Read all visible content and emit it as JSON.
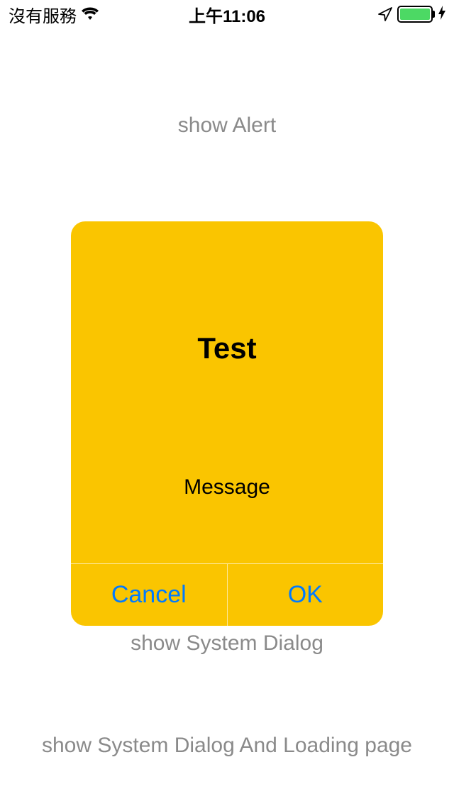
{
  "statusBar": {
    "carrier": "沒有服務",
    "time": "上午11:06"
  },
  "links": {
    "showAlert": "show Alert",
    "showSystemDialog": "show System Dialog",
    "showSystemDialogAndLoading": "show System Dialog And Loading page"
  },
  "alert": {
    "title": "Test",
    "message": "Message",
    "cancel": "Cancel",
    "ok": "OK"
  },
  "colors": {
    "alertBg": "#fac500",
    "buttonText": "#007aff",
    "linkText": "#8a8a8a",
    "batteryFill": "#4cd964"
  }
}
